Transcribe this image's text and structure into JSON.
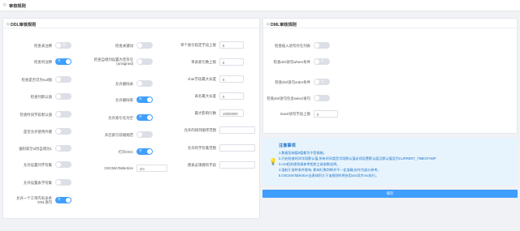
{
  "page": {
    "title": "审核规则"
  },
  "ddl": {
    "title": "DDL审核规则",
    "col1": [
      {
        "label": "检查表注释",
        "state": "off",
        "text": "关"
      },
      {
        "label": "检查列注释",
        "state": "on",
        "text": "开"
      },
      {
        "label": "检查是否可为null值",
        "state": "off",
        "text": ""
      },
      {
        "label": "检查列默认值",
        "state": "off",
        "text": ""
      },
      {
        "label": "检查时间字段默认值",
        "state": "off",
        "text": ""
      },
      {
        "label": "是否允许使用外键",
        "state": "off",
        "text": ""
      },
      {
        "label": "强制非空id列自增为1",
        "state": "off",
        "text": ""
      },
      {
        "label": "允许设置列字符集",
        "state": "off",
        "text": ""
      },
      {
        "label": "允许设置表字符集",
        "state": "off",
        "text": ""
      },
      {
        "label": "允许一个工单内有多条\nDDL语句",
        "state": "on",
        "text": "开"
      }
    ],
    "col2": [
      {
        "label": "检查关键词",
        "state": "off",
        "text": ""
      },
      {
        "label": "检查自增列设置为无符号\n(unsigned)",
        "state": "off",
        "text": ""
      },
      {
        "label": "允许删除表",
        "state": "off",
        "text": ""
      },
      {
        "label": "允许删除库",
        "state": "on",
        "text": "开"
      },
      {
        "label": "允许索引名为空",
        "state": "on",
        "text": "开"
      },
      {
        "label": "开启索引前缀规范",
        "state": "off",
        "text": ""
      },
      {
        "label": "打开OSC",
        "state": "on",
        "text": "开"
      }
    ],
    "osc_label": "OSCMinTableSize",
    "osc_value": "2m",
    "col3": [
      {
        "label": "单个索引指定字段上限",
        "value": "5"
      },
      {
        "label": "单表索引数上限",
        "value": "5"
      },
      {
        "label": "char字段最大长度",
        "value": "0"
      },
      {
        "label": "表名最大长度",
        "value": "0"
      },
      {
        "label": "最大影响行数",
        "value": "10000000"
      },
      {
        "label": "允许的排列顺序范围",
        "value": ""
      },
      {
        "label": "允许的字符集范围",
        "value": ""
      },
      {
        "label": "建表必须拥有字段",
        "value": ""
      }
    ]
  },
  "dml": {
    "title": "DML审核规则",
    "rows": [
      {
        "label": "检查插入语句存在列表",
        "state": "off",
        "text": ""
      },
      {
        "label": "检查dml语句where条件",
        "state": "off",
        "text": "关"
      },
      {
        "label": "检查dml语句order条件",
        "state": "off",
        "text": "关"
      },
      {
        "label": "检查dml语句包含select语句",
        "state": "off",
        "text": ""
      }
    ],
    "insert_label": "insert语句字段上限",
    "insert_value": "0"
  },
  "notice": {
    "title": "注意事项",
    "lines": [
      "1.数据型阀值0值都为不受限制。",
      "2.开启检查时间字段默认值,所有时间类型字段默认值必须设置默认值且默认值设为CURRENT_TIMESTAMP",
      "3.osc相关规则请参考相关工具参数说明。",
      "4.强制于各种条件影响, 影响行数判断并不一定准确,仅作为部分参考。",
      "5.OSCMinTableSize当表体积大于该规则时将启用osc同步osc执行。"
    ]
  },
  "save_button": "保存",
  "colors": {
    "accent": "#409eff",
    "off": "#dcdfe6",
    "notice_bg": "#e8f4fd"
  }
}
